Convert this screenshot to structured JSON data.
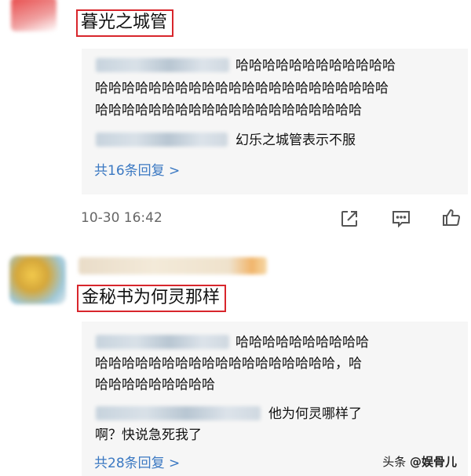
{
  "comment1": {
    "title": "暮光之城管",
    "reply_lines": [
      "哈哈哈哈哈哈哈哈哈哈哈哈",
      "哈哈哈哈哈哈哈哈哈哈哈哈哈哈哈哈哈哈哈哈哈哈",
      "哈哈哈哈哈哈哈哈哈哈哈哈哈哈哈哈哈哈哈哈"
    ],
    "reply2": "幻乐之城管表示不服",
    "more_replies": "共16条回复 >",
    "timestamp": "10-30 16:42"
  },
  "comment2": {
    "title": "金秘书为何灵那样",
    "reply_lines": [
      "哈哈哈哈哈哈哈哈哈哈",
      "哈哈哈哈哈哈哈哈哈哈哈哈哈哈哈哈哈哈，哈",
      "哈哈哈哈哈哈哈哈哈"
    ],
    "reply2_lines": [
      "他为何灵哪样了",
      "啊？快说急死我了"
    ],
    "more_replies": "共28条回复 >"
  },
  "actions": {
    "share_icon": "share-icon",
    "comment_icon": "comment-icon",
    "like_icon": "thumbs-up-icon"
  },
  "watermark": {
    "prefix": "头条 ",
    "brand": "@娱骨儿"
  },
  "colors": {
    "highlight_border": "#d8262c",
    "link": "#3a78c2",
    "panel_bg": "#f6f6f6"
  }
}
